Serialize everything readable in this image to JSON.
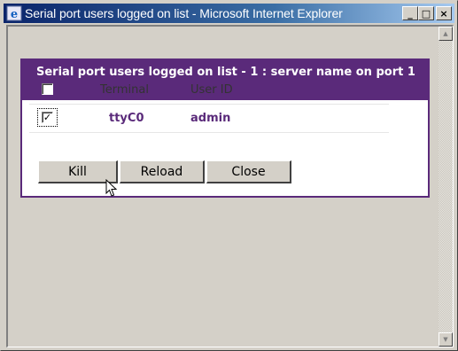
{
  "window": {
    "title": "Serial port users logged on list - Microsoft Internet Explorer",
    "buttons": {
      "minimize": "_",
      "maximize": "□",
      "close": "×"
    }
  },
  "panel": {
    "title": "Serial port users logged on list - 1 : server name on port 1",
    "columns": {
      "terminal": "Terminal",
      "user_id": "User ID"
    },
    "rows": [
      {
        "checked": true,
        "terminal": "ttyC0",
        "user_id": "admin"
      }
    ],
    "check_mark": "✓",
    "buttons": {
      "kill": "Kill",
      "reload": "Reload",
      "close": "Close"
    }
  },
  "icons": [
    "ie-icon",
    "minimize-icon",
    "maximize-icon",
    "close-icon",
    "scroll-up-icon",
    "scroll-down-icon",
    "mouse-pointer-icon"
  ],
  "colors": {
    "accent": "#5a2a7a",
    "titlebar": "#0a246a",
    "chrome": "#d4d0c8"
  }
}
